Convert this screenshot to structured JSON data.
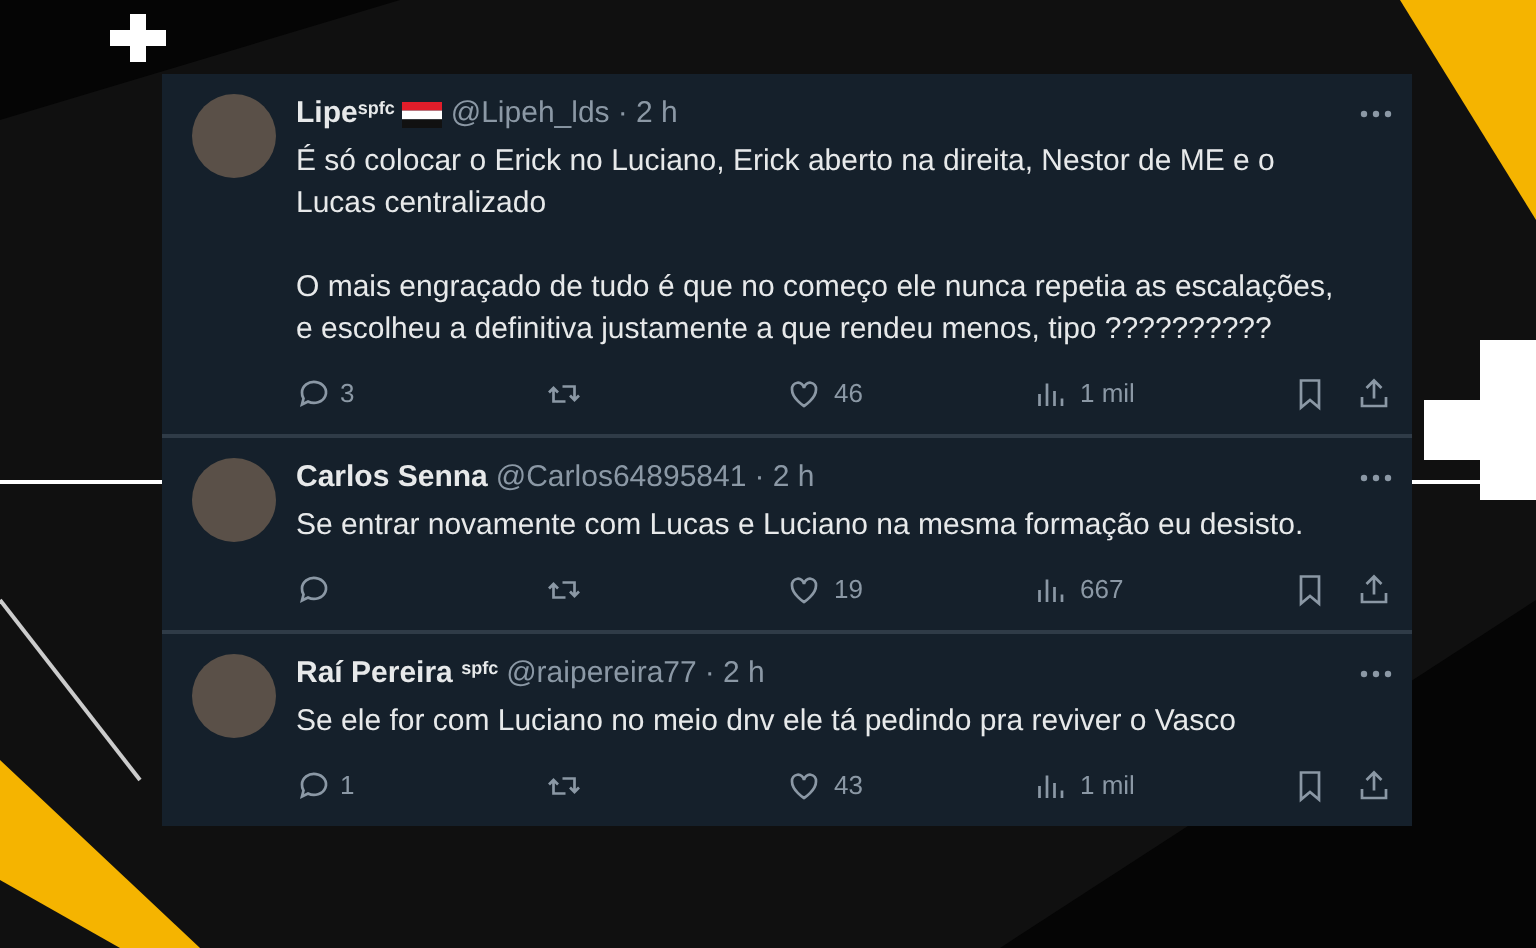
{
  "tweets": [
    {
      "name": "Lipe$^{spfc}$",
      "flag": true,
      "handle": "@Lipeh_lds",
      "time": "· 2 h",
      "paragraphs": [
        "É só colocar o Erick no Luciano, Erick aberto na direita, Nestor de ME e o Lucas centralizado",
        "O mais engraçado de tudo é que no começo ele nunca repetia as escalações, e escolheu a definitiva justamente a que rendeu menos, tipo ??????????"
      ],
      "replies": "3",
      "likes": "46",
      "views": "1 mil"
    },
    {
      "name": "Carlos Senna",
      "flag": false,
      "handle": "@Carlos64895841",
      "time": "· 2 h",
      "paragraphs": [
        "Se entrar novamente com Lucas e Luciano na mesma formação eu desisto."
      ],
      "likes": "19",
      "views": "667"
    },
    {
      "name": "Raí Pereira $^{spfc}$",
      "flag": false,
      "handle": "@raipereira77",
      "time": "· 2 h",
      "paragraphs": [
        "Se ele for com Luciano no meio dnv ele tá pedindo pra reviver o Vasco"
      ],
      "replies": "1",
      "likes": "43",
      "views": "1 mil"
    }
  ]
}
